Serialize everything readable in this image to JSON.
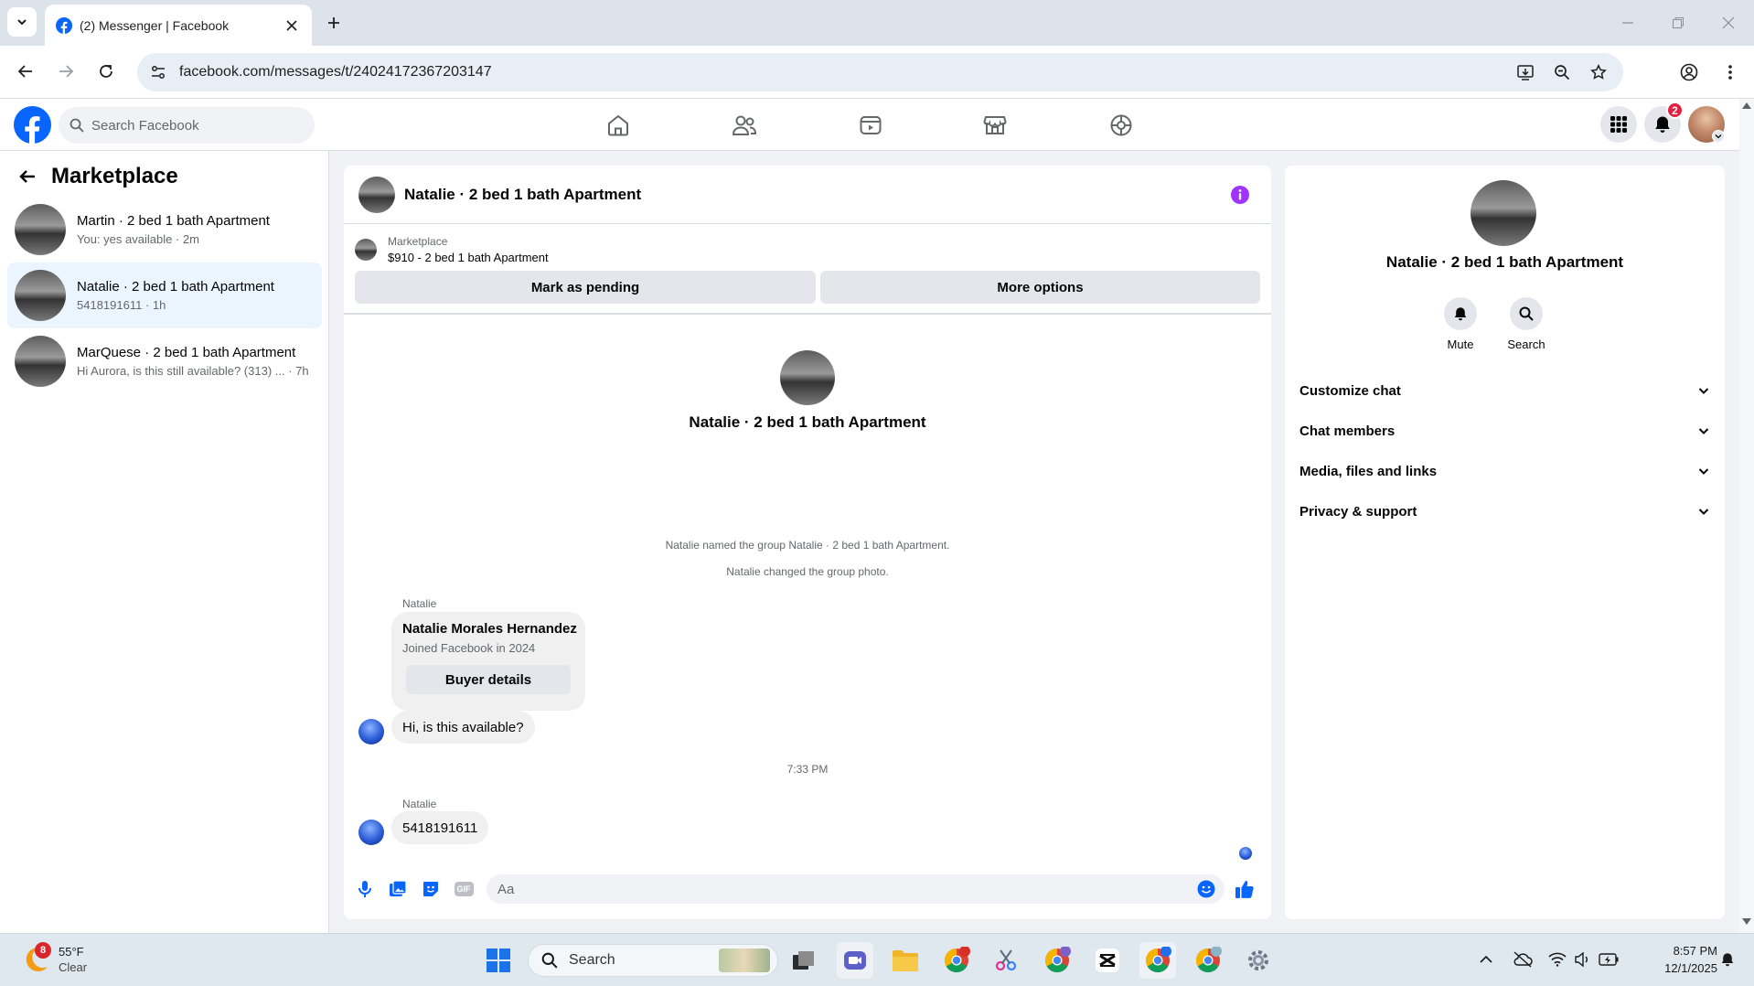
{
  "browser": {
    "tab_title": "(2) Messenger | Facebook",
    "url": "facebook.com/messages/t/24024172367203147"
  },
  "fb": {
    "search_placeholder": "Search Facebook",
    "notification_count": "2",
    "brand_color": "#0866ff"
  },
  "left": {
    "title": "Marketplace",
    "conversations": [
      {
        "name": "Martin · 2 bed 1 bath Apartment",
        "preview": "You: yes available · 2m",
        "selected": false
      },
      {
        "name": "Natalie · 2 bed 1 bath Apartment",
        "preview": "5418191611 · 1h",
        "selected": true
      },
      {
        "name": "MarQuese · 2 bed 1 bath Apartment",
        "preview": "Hi Aurora, is this still available? (313) ... · 7h",
        "selected": false
      }
    ]
  },
  "chat": {
    "title": "Natalie · 2 bed 1 bath Apartment",
    "listing_source": "Marketplace",
    "listing_title": "$910 - 2 bed 1 bath Apartment",
    "mark_pending_label": "Mark as pending",
    "more_options_label": "More options",
    "group_name": "Natalie · 2 bed 1 bath Apartment",
    "event_1": "Natalie named the group Natalie · 2 bed 1 bath Apartment.",
    "event_2": "Natalie changed the group photo.",
    "sender_1": "Natalie",
    "card_name": "Natalie Morales Hernandez",
    "card_sub": "Joined Facebook in 2024",
    "card_button": "Buyer details",
    "msg_1": "Hi, is this available?",
    "timestamp": "7:33 PM",
    "sender_2": "Natalie",
    "msg_2": "5418191611",
    "composer_placeholder": "Aa",
    "gif_label": "GIF"
  },
  "right": {
    "name": "Natalie · 2 bed 1 bath Apartment",
    "mute_label": "Mute",
    "search_label": "Search",
    "sections": [
      "Customize chat",
      "Chat members",
      "Media, files and links",
      "Privacy & support"
    ]
  },
  "taskbar": {
    "weather_temp": "55°F",
    "weather_desc": "Clear",
    "weather_badge": "8",
    "search_label": "Search",
    "time": "8:57 PM",
    "date": "12/1/2025"
  }
}
